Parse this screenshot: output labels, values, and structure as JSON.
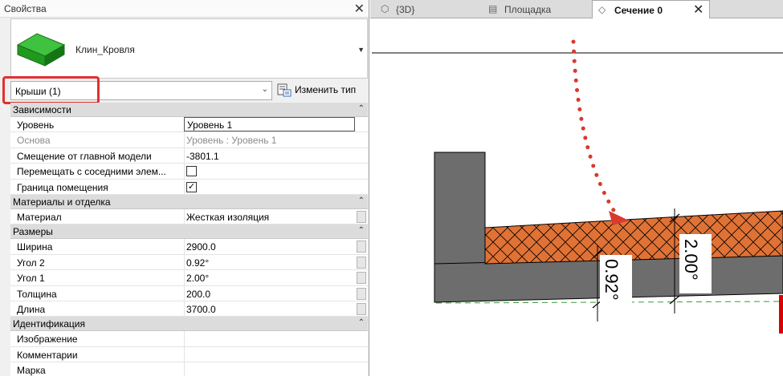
{
  "properties_panel": {
    "title": "Свойства",
    "type_name": "Клин_Кровля",
    "filter": {
      "text": "Крыши (1)"
    },
    "edit_type_label": "Изменить тип",
    "groups": [
      {
        "label": "Зависимости",
        "rows": [
          {
            "name": "Уровень",
            "value": "Уровень 1",
            "state": "editing"
          },
          {
            "name": "Основа",
            "value": "Уровень : Уровень 1",
            "state": "disabled"
          },
          {
            "name": "Смещение от главной модели",
            "value": "-3801.1"
          },
          {
            "name": "Перемещать с соседними элем...",
            "checkbox": false
          },
          {
            "name": "Граница помещения",
            "checkbox": true
          }
        ]
      },
      {
        "label": "Материалы и отделка",
        "rows": [
          {
            "name": "Материал",
            "value": "Жесткая изоляция",
            "button": true
          }
        ]
      },
      {
        "label": "Размеры",
        "rows": [
          {
            "name": "Ширина",
            "value": "2900.0",
            "button": true
          },
          {
            "name": "Угол 2",
            "value": "0.92°",
            "button": true
          },
          {
            "name": "Угол 1",
            "value": "2.00°",
            "button": true
          },
          {
            "name": "Толщина",
            "value": "200.0",
            "button": true
          },
          {
            "name": "Длина",
            "value": "3700.0",
            "button": true
          }
        ]
      },
      {
        "label": "Идентификация",
        "rows": [
          {
            "name": "Изображение",
            "value": ""
          },
          {
            "name": "Комментарии",
            "value": ""
          },
          {
            "name": "Марка",
            "value": ""
          }
        ]
      }
    ]
  },
  "view_tabs": [
    {
      "label": "{3D}",
      "icon": "3d-view-icon",
      "active": false
    },
    {
      "label": "Площадка",
      "icon": "floor-plan-icon",
      "active": false
    },
    {
      "label": "Сечение 0",
      "icon": "section-view-icon",
      "active": true
    }
  ],
  "drawing": {
    "dimension_left": "0.92°",
    "dimension_right": "2.00°",
    "colors": {
      "insulation": "#e07236",
      "concrete": "#6d6d6d",
      "arrow": "#d83a2e",
      "level_line": "#3a9a3a",
      "highlight": "#e03030"
    }
  }
}
